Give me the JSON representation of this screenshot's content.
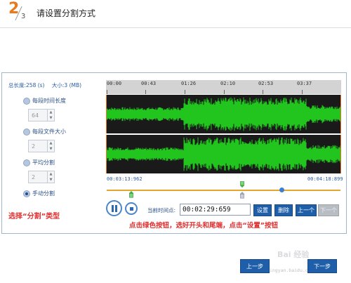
{
  "header": {
    "step_current": "2",
    "step_total": "3",
    "title": "请设置分割方式"
  },
  "summary": {
    "total_length": "总长度:258 (s)",
    "size": "大小:3 (MB)"
  },
  "options": [
    {
      "label": "每段时间长度",
      "value": "64",
      "selected": false
    },
    {
      "label": "每段文件大小",
      "value": "2",
      "selected": false
    },
    {
      "label": "平均分割",
      "value": "2",
      "selected": false
    },
    {
      "label": "手动分割",
      "selected": true
    }
  ],
  "select_note": "选择“分割”类型",
  "timeline_labels": [
    "00:00",
    "00:43",
    "01:26",
    "02:10",
    "02:53",
    "03:37"
  ],
  "selection": {
    "start_time": "00:03:13:962",
    "end_time": "00:04:18:899"
  },
  "playback": {
    "current_label": "当前时间点:",
    "current_value": "00:02:29:659"
  },
  "buttons": {
    "set": "设置",
    "delete": "删除",
    "prev": "上一个",
    "next": "下一个"
  },
  "instruction": "点击绿色按钮，选好开头和尾端，点击“设置”按钮",
  "nav": {
    "prev": "上一步",
    "next": "下一步"
  },
  "watermark": {
    "text": "Bai 经验",
    "url": "jingyan.baidu.com"
  },
  "colors": {
    "accent": "#1f5ea8",
    "wave": "#22c41e",
    "highlight": "#e87a1c",
    "note": "#e03030"
  }
}
